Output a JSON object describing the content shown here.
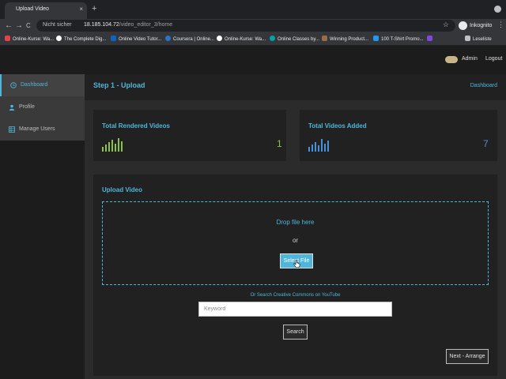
{
  "browser": {
    "tab_title": "Upload Video",
    "tab_close": "×",
    "new_tab": "+",
    "back": "←",
    "forward": "→",
    "reload": "C",
    "insecure_label": "Nicht sicher",
    "url_host": "18.185.104.72",
    "url_path": "/video_editor_3/home",
    "star": "☆",
    "incognito_label": "Inkognito",
    "menu": "⋮",
    "bookmarks": [
      {
        "label": "Online-Kurse: Wa...",
        "color": "#e2424d"
      },
      {
        "label": "The Complete Dig...",
        "color": "#ffffff"
      },
      {
        "label": "Online Video Tutor...",
        "color": "#0a66c2"
      },
      {
        "label": "Coursera | Online...",
        "color": "#2a73cc"
      },
      {
        "label": "Online-Kurse: Wa...",
        "color": "#ffffff"
      },
      {
        "label": "Online Classes by...",
        "color": "#00a4a6"
      },
      {
        "label": "Winning Product...",
        "color": "#9b6b43"
      },
      {
        "label": "100 T-Shirt Promo...",
        "color": "#2196f3"
      },
      {
        "label": "",
        "color": "#7a4ad9"
      }
    ],
    "reading_list": "Leseliste"
  },
  "topbar": {
    "user_name": "Admin",
    "logout": "Logout"
  },
  "sidebar": {
    "items": [
      {
        "label": "Dashboard",
        "icon": "clock-icon",
        "active": true
      },
      {
        "label": "Profile",
        "icon": "user-icon",
        "active": false
      },
      {
        "label": "Manage Users",
        "icon": "table-icon",
        "active": false
      }
    ]
  },
  "header": {
    "step_title": "Step 1 - Upload",
    "breadcrumb": "Dashboard"
  },
  "stats": {
    "rendered": {
      "title": "Total Rendered Videos",
      "value": "1",
      "color": "#8bc34a"
    },
    "added": {
      "title": "Total Videos Added",
      "value": "7",
      "color": "#4a90d9"
    }
  },
  "upload": {
    "title": "Upload Video",
    "drop_text": "Drop file here",
    "or_text": "or",
    "select_label": "Select File",
    "youtube_link": "Or Search Creative Commons on YouTube",
    "keyword_placeholder": "Keyword",
    "search_label": "Search",
    "next_label": "Next - Arrange"
  },
  "colors": {
    "accent": "#4fb6d9",
    "background": "#2b2b2b",
    "panel": "#212121"
  }
}
